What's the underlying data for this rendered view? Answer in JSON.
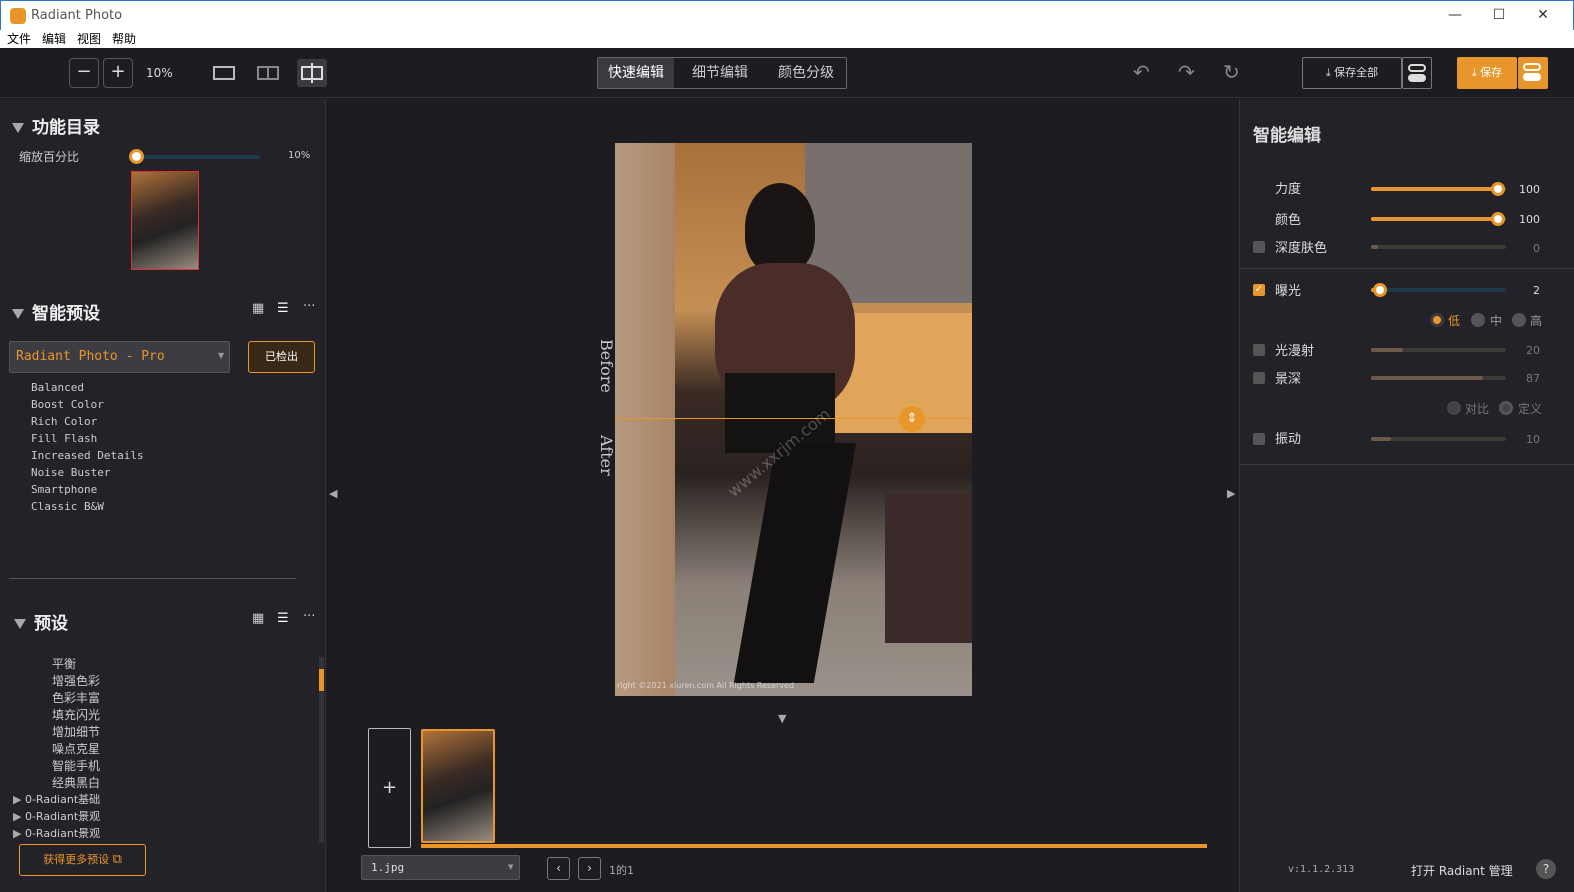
{
  "window": {
    "title": "Radiant Photo",
    "minimize": "—",
    "maximize": "☐",
    "close": "✕"
  },
  "menu": [
    "文件",
    "编辑",
    "视图",
    "帮助"
  ],
  "toolbar": {
    "zoom_out": "−",
    "zoom_in": "+",
    "zoom_level": "10%",
    "modes": [
      "快速编辑",
      "细节编辑",
      "颜色分级"
    ],
    "active_mode": 0,
    "save_all": "保存全部",
    "save": "保存"
  },
  "left": {
    "catalog": {
      "title": "功能目录",
      "zoom_label": "缩放百分比",
      "zoom_value": "10%"
    },
    "smart_preset": {
      "title": "智能预设",
      "dropdown": "Radiant Photo - Pro",
      "detected_button": "已检出",
      "items": [
        "Balanced",
        "Boost Color",
        "Rich Color",
        "Fill Flash",
        "Increased Details",
        "Noise Buster",
        "Smartphone",
        "Classic B&W"
      ]
    },
    "presets": {
      "title": "预设",
      "items": [
        "平衡",
        "增强色彩",
        "色彩丰富",
        "填充闪光",
        "增加细节",
        "噪点克星",
        "智能手机",
        "经典黑白"
      ],
      "groups": [
        "0-Radiant基础",
        "0-Radiant景观",
        "0-Radiant景观"
      ],
      "get_more": "获得更多预设"
    }
  },
  "center": {
    "before_label": "Before",
    "after_label": "After",
    "watermark": "www.xxrjm.com",
    "copyright": "right ©2021 xiuren.com  All Rights Reserved",
    "file_select": "1.jpg",
    "page_info": "1的1",
    "add_label": "+"
  },
  "right": {
    "title": "智能编辑",
    "sliders": [
      {
        "label": "力度",
        "value": "100",
        "checkbox": false,
        "fraction": 0.94
      },
      {
        "label": "颜色",
        "value": "100",
        "checkbox": false,
        "fraction": 0.94
      },
      {
        "label": "深度肤色",
        "value": "0",
        "checkbox": true,
        "checked": false,
        "fraction": 0.05
      },
      {
        "label": "曝光",
        "value": "2",
        "checkbox": true,
        "checked": true,
        "fraction": 0.06
      },
      {
        "label": "光漫射",
        "value": "20",
        "checkbox": true,
        "checked": false,
        "fraction": 0.24
      },
      {
        "label": "景深",
        "value": "87",
        "checkbox": true,
        "checked": false,
        "fraction": 0.82
      },
      {
        "label": "振动",
        "value": "10",
        "checkbox": true,
        "checked": false,
        "fraction": 0.15
      }
    ],
    "exposure_levels": [
      "低",
      "中",
      "高"
    ],
    "depth_modes": [
      "对比",
      "定义"
    ],
    "version": "v:1.1.2.313",
    "open_manager": "打开 Radiant 管理",
    "help": "?"
  },
  "colors": {
    "accent": "#e8962c",
    "panel": "#232228",
    "bg": "#1d1c21"
  }
}
